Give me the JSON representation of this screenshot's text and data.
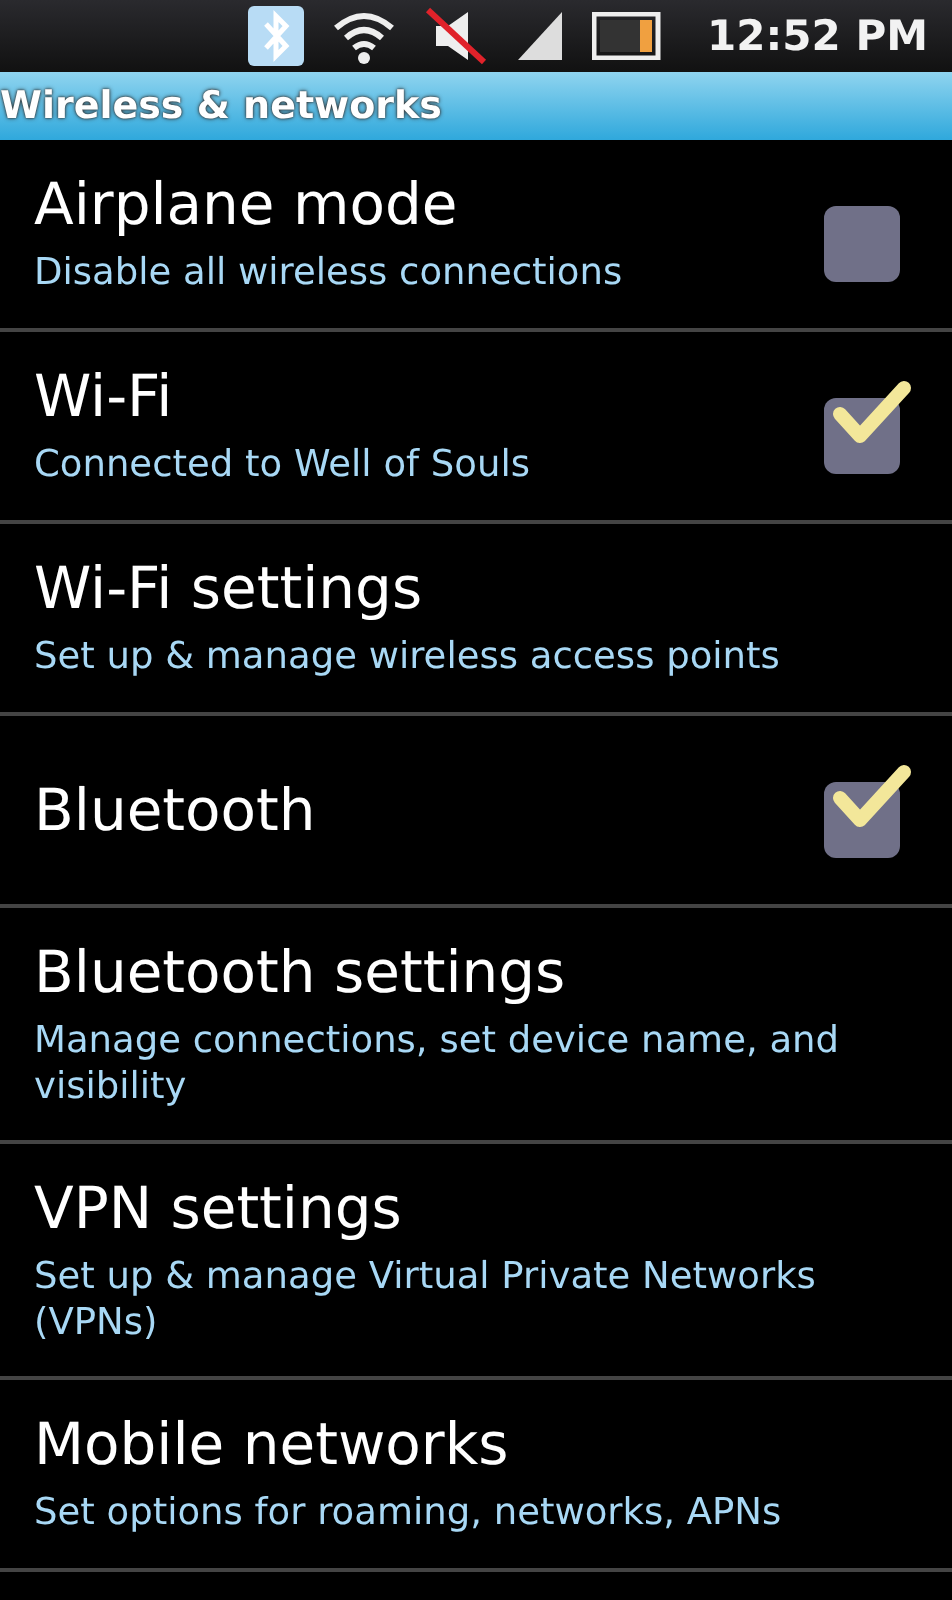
{
  "status_bar": {
    "time": "12:52 PM"
  },
  "header": {
    "title": "Wireless & networks"
  },
  "items": [
    {
      "kind": "checkbox",
      "title": "Airplane mode",
      "summary": "Disable all wireless connections",
      "checked": false
    },
    {
      "kind": "checkbox",
      "title": "Wi-Fi",
      "summary": "Connected to Well of Souls",
      "checked": true
    },
    {
      "kind": "link",
      "title": "Wi-Fi settings",
      "summary": "Set up & manage wireless access points"
    },
    {
      "kind": "checkbox",
      "title": "Bluetooth",
      "checked": true
    },
    {
      "kind": "link",
      "title": "Bluetooth settings",
      "summary": "Manage connections, set device name, and visibility"
    },
    {
      "kind": "link",
      "title": "VPN settings",
      "summary": "Set up & manage Virtual Private Networks (VPNs)"
    },
    {
      "kind": "link",
      "title": "Mobile networks",
      "summary": "Set options for roaming, networks, APNs"
    }
  ]
}
